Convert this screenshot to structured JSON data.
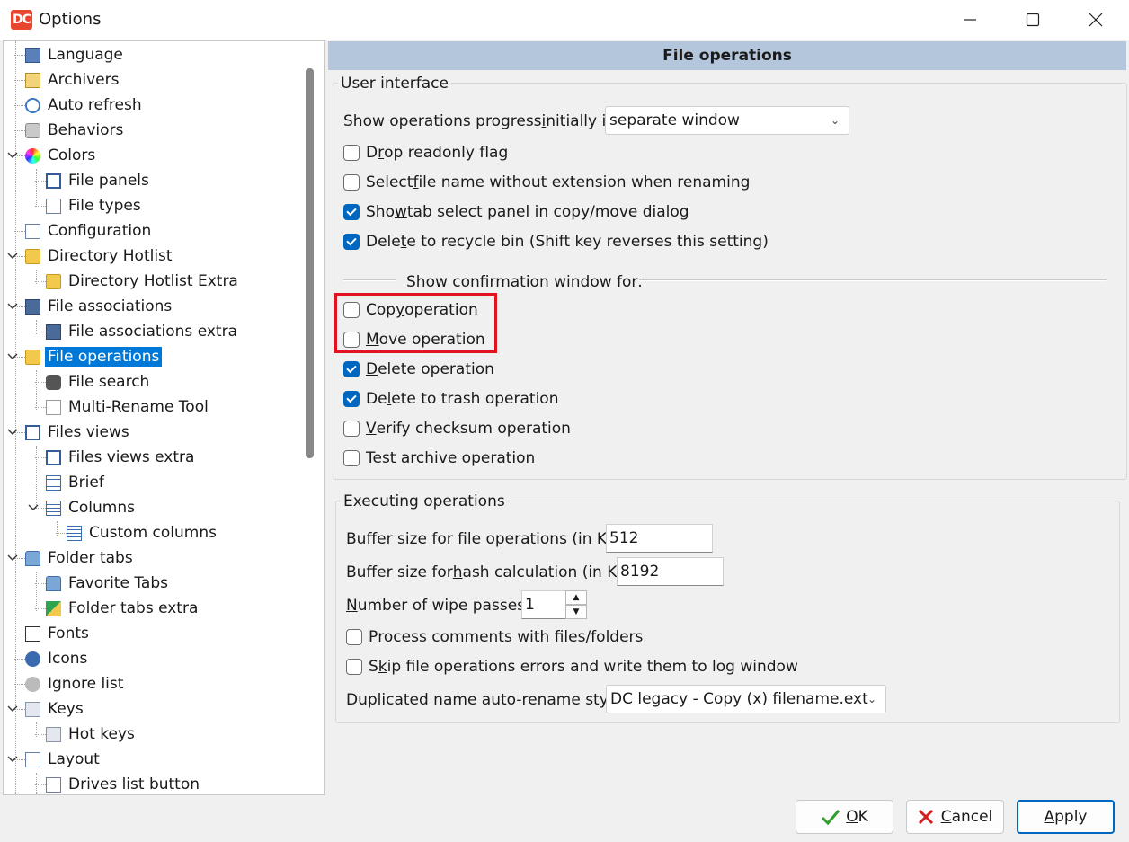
{
  "window": {
    "title": "Options"
  },
  "tree": {
    "items": [
      {
        "label": "Language"
      },
      {
        "label": "Archivers"
      },
      {
        "label": "Auto refresh"
      },
      {
        "label": "Behaviors"
      },
      {
        "label": "Colors"
      },
      {
        "label": "File panels"
      },
      {
        "label": "File types"
      },
      {
        "label": "Configuration"
      },
      {
        "label": "Directory Hotlist"
      },
      {
        "label": "Directory Hotlist Extra"
      },
      {
        "label": "File associations"
      },
      {
        "label": "File associations extra"
      },
      {
        "label": "File operations"
      },
      {
        "label": "File search"
      },
      {
        "label": "Multi-Rename Tool"
      },
      {
        "label": "Files views"
      },
      {
        "label": "Files views extra"
      },
      {
        "label": "Brief"
      },
      {
        "label": "Columns"
      },
      {
        "label": "Custom columns"
      },
      {
        "label": "Folder tabs"
      },
      {
        "label": "Favorite Tabs"
      },
      {
        "label": "Folder tabs extra"
      },
      {
        "label": "Fonts"
      },
      {
        "label": "Icons"
      },
      {
        "label": "Ignore list"
      },
      {
        "label": "Keys"
      },
      {
        "label": "Hot keys"
      },
      {
        "label": "Layout"
      },
      {
        "label": "Drives list button"
      }
    ]
  },
  "page": {
    "header": "File operations",
    "ui_group": {
      "title": "User interface",
      "progress": {
        "label_pre": "Show operations progress ",
        "label_ul": "i",
        "label_post": "nitially in",
        "value": "separate window"
      },
      "drop_readonly": {
        "pre": "D",
        "ul": "r",
        "post": "op readonly flag",
        "checked": false
      },
      "select_name": {
        "pre": "Select ",
        "ul": "f",
        "post": "ile name without extension when renaming",
        "checked": false
      },
      "show_tab": {
        "pre": "Sho",
        "ul": "w",
        "post": " tab select panel in copy/move dialog",
        "checked": true
      },
      "recycle": {
        "pre": "Dele",
        "ul": "t",
        "post": "e to recycle bin (Shift key reverses this setting)",
        "checked": true
      },
      "confirm_title": "Show confirmation window for:",
      "copy_op": {
        "pre": "Cop",
        "ul": "y",
        "post": " operation",
        "checked": false
      },
      "move_op": {
        "pre": "",
        "ul": "M",
        "post": "ove operation",
        "checked": false
      },
      "delete_op": {
        "pre": "",
        "ul": "D",
        "post": "elete operation",
        "checked": true
      },
      "trash_op": {
        "pre": "De",
        "ul": "l",
        "post": "ete to trash operation",
        "checked": true
      },
      "verify_op": {
        "pre": "",
        "ul": "V",
        "post": "erify checksum operation",
        "checked": false
      },
      "test_op": {
        "pre": "Test archive operation",
        "ul": "",
        "post": "",
        "checked": false
      }
    },
    "exec_group": {
      "title": "Executing operations",
      "buffer": {
        "pre": "",
        "ul": "B",
        "post": "uffer size for file operations (in KB):",
        "value": "512"
      },
      "hash": {
        "pre": "Buffer size for ",
        "ul": "h",
        "post": "ash calculation (in KB):",
        "value": "8192"
      },
      "wipe": {
        "pre": "",
        "ul": "N",
        "post": "umber of wipe passes:",
        "value": "1"
      },
      "comments": {
        "pre": "",
        "ul": "P",
        "post": "rocess comments with files/folders",
        "checked": false
      },
      "skip": {
        "pre": "S",
        "ul": "k",
        "post": "ip file operations errors and write them to log window",
        "checked": false
      },
      "rename_style": {
        "label": "Duplicated name auto-rename style:",
        "value": "DC legacy - Copy (x) filename.ext"
      }
    }
  },
  "buttons": {
    "ok": {
      "ul": "O",
      "post": "K"
    },
    "cancel": {
      "ul": "C",
      "post": "ancel"
    },
    "apply": {
      "ul": "A",
      "post": "pply"
    }
  },
  "colors": {
    "accent": "#0067c0",
    "selection": "#0078d7",
    "header_bg": "#b4c6dc",
    "highlight": "#e0141e"
  }
}
